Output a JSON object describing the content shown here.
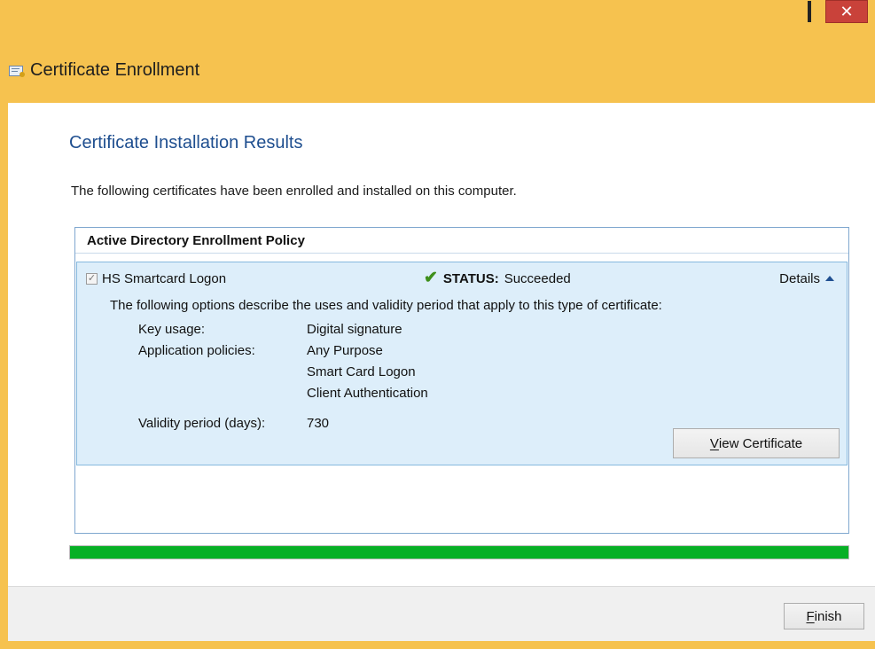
{
  "window": {
    "title": "Certificate Enrollment",
    "controls": {
      "minimize_icon": "minimize-icon",
      "maximize_icon": "maximize-icon",
      "close_icon": "close-icon"
    },
    "accent_color": "#f6c24f",
    "close_color": "#c9423a"
  },
  "page": {
    "section_title": "Certificate Installation Results",
    "intro_text": "The following certificates have been enrolled and installed on this computer."
  },
  "policy": {
    "header": "Active Directory Enrollment Policy",
    "items": [
      {
        "name": "HS Smartcard Logon",
        "checked": true,
        "status_label": "STATUS:",
        "status_value": "Succeeded",
        "details_label": "Details",
        "description": "The following options describe the uses and validity period that apply to this type of certificate:",
        "key_usage_label": "Key usage:",
        "key_usage_value": "Digital signature",
        "app_policies_label": "Application policies:",
        "app_policies_values": [
          "Any Purpose",
          "Smart Card Logon",
          "Client Authentication"
        ],
        "validity_label": "Validity period (days):",
        "validity_value": "730",
        "view_button": {
          "mnemonic": "V",
          "rest": "iew Certificate"
        }
      }
    ]
  },
  "progress": {
    "percent": 100,
    "color": "#06b025"
  },
  "footer": {
    "finish_button": {
      "mnemonic": "F",
      "rest": "inish"
    }
  }
}
